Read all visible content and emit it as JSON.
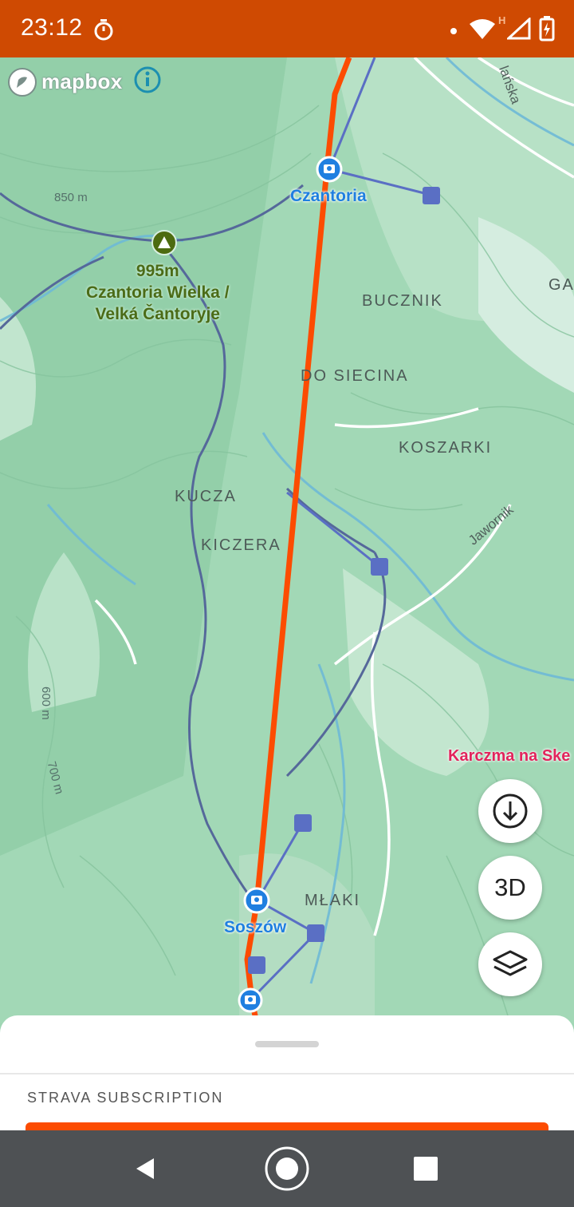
{
  "status_bar": {
    "time": "23:12",
    "icons": [
      "stopwatch-icon",
      "notification-dot-icon",
      "wifi-icon",
      "signal-icon",
      "battery-charging-icon"
    ],
    "network_badge": "H"
  },
  "map": {
    "attribution": {
      "logo_text": "mapbox",
      "info_icon": "info-icon"
    },
    "peak": {
      "elevation": "995m",
      "name_line1": "Czantoria Wielka /",
      "name_line2": "Velká Čantoryje"
    },
    "contour_labels": [
      "850 m",
      "600 m",
      "700 m"
    ],
    "places": [
      "BUCZNIK",
      "DO SIECINA",
      "KOSZARKI",
      "KUCZA",
      "KICZERA",
      "MŁAKI",
      "GA"
    ],
    "lift_stations": [
      "Czantoria",
      "Soszów"
    ],
    "poi": "Karczma na Ske",
    "roads": [
      "Jawornik",
      "lańska"
    ],
    "route_color": "#fc4c02",
    "lift_line_color": "#5a6fc4"
  },
  "controls": {
    "download": "download-icon",
    "three_d": "3D",
    "layers": "layers-icon"
  },
  "bottom_sheet": {
    "heading": "STRAVA SUBSCRIPTION",
    "accent_color": "#fc4c02"
  },
  "nav_bar": {
    "buttons": [
      "back-icon",
      "home-icon",
      "recents-icon"
    ]
  }
}
